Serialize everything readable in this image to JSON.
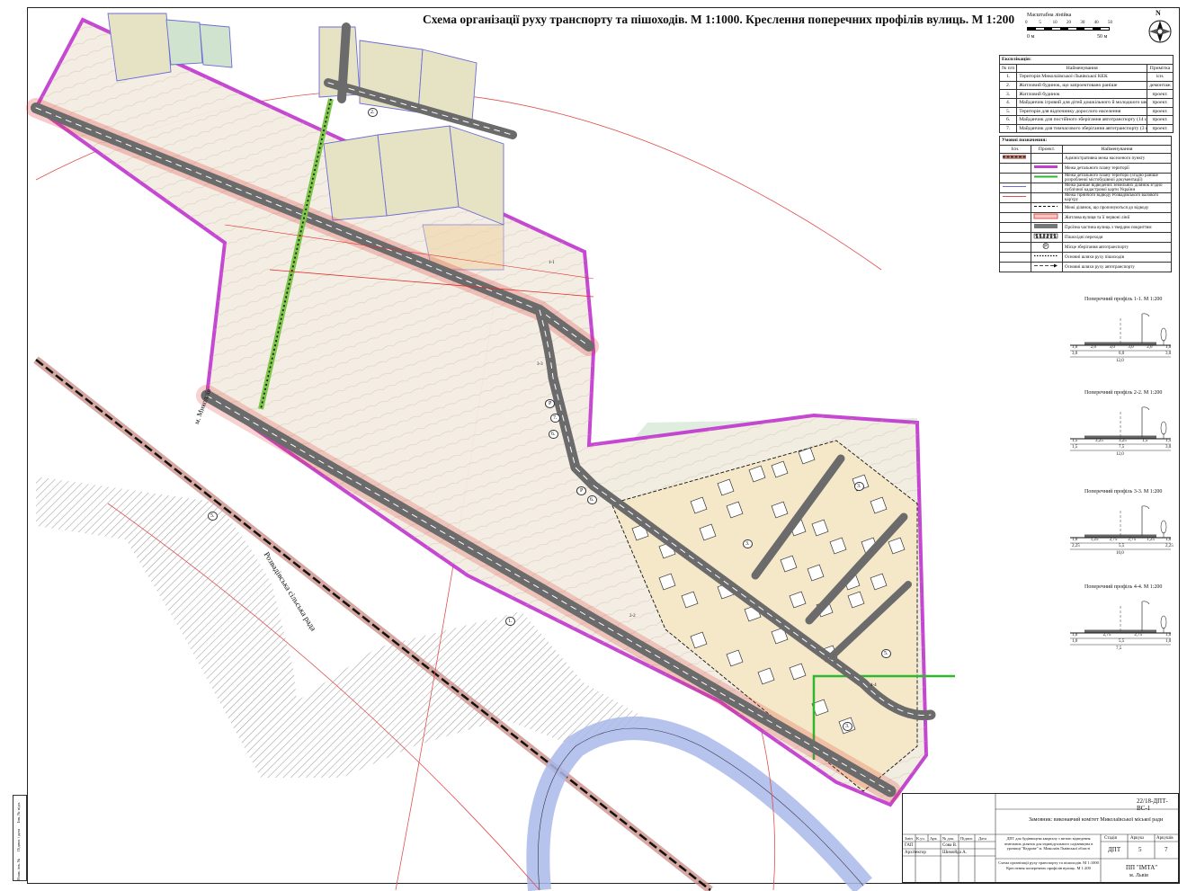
{
  "title": "Схема організації руху транспорту та пішоходів. М 1:1000. Креслення поперечних профілів вулиць. М 1:200",
  "scale": {
    "label": "Масштабна лінійка",
    "ticks": [
      "0",
      "5",
      "10",
      "20",
      "30",
      "40",
      "50"
    ],
    "left_unit": "0 м",
    "right_unit": "50 м"
  },
  "compass": {
    "north": "N"
  },
  "map_labels": {
    "city": "м. Миколаїв",
    "council": "Розвадівська сільська рада",
    "road_cross_1": "1-1",
    "road_cross_2": "2-2",
    "road_cross_3": "3-3",
    "road_cross_4": "4-4",
    "marker_1": "1.",
    "marker_2": "2.",
    "marker_3": "3.",
    "marker_5": "5.",
    "marker_6": "6.",
    "marker_7": "7.",
    "parking": "P",
    "zone_1": "1.",
    "zone_5": "5."
  },
  "explication": {
    "title": "Експлікація:",
    "headers": [
      "№ п/п",
      "Найменування",
      "Примітка"
    ],
    "rows": [
      [
        "1.",
        "Територія Миколаївської-Львівської КЕК",
        "існ."
      ],
      [
        "2.",
        "Житловий будинок, що запроектовано раніше",
        "демонтаж"
      ],
      [
        "3.",
        "Житловий будинок",
        "проект."
      ],
      [
        "4.",
        "Майданчик ігровий для дітей дошкільного й молодшого шкільного віку",
        "проект."
      ],
      [
        "5.",
        "Територія для відпочинку дорослого населення",
        "проект."
      ],
      [
        "6.",
        "Майданчик для постійного зберігання автотранспорту (14 шт.)",
        "проект."
      ],
      [
        "7.",
        "Майданчик для тимчасового зберігання автотранспорту (3 шт.)",
        "проект."
      ]
    ]
  },
  "legend": {
    "title": "Умовні позначення:",
    "headers": [
      "Існ.",
      "Проект.",
      "Найменування"
    ],
    "rows": [
      "Адміністративна межа населеного пункту",
      "Межа детального плану території",
      "Межа детального плану території (згідно раніше розробленої містобудівної документації)",
      "Межа раніше відведених земельних ділянок згідно публічної кадастрової карти України",
      "Межа гірничого відводу Розвадівського валового кар'єру",
      "Межі ділянок, що пропонуються до відводу",
      "Житлова вулиця та її червоні лінії",
      "Проїзна частина вулиць з твердим покриттям",
      "Пішохідні переходи",
      "Місце зберігання автотранспорту",
      "Основні шляхи руху пішоходів",
      "Основні шляхи руху автотранспорту"
    ]
  },
  "profiles": [
    {
      "title": "Поперечний профіль 1-1. М 1:200",
      "top": [
        "1,0",
        "2,0",
        "3,0",
        "3,0",
        "2,0",
        "1,0"
      ],
      "mid": [
        "3,0",
        "6,0",
        "3,0"
      ],
      "total": "12,0"
    },
    {
      "title": "Поперечний профіль 2-2. М 1:200",
      "top": [
        "1,5",
        "3,25",
        "3,25",
        "1,5",
        "1,5"
      ],
      "mid": [
        "1,5",
        "7,5",
        "3,0"
      ],
      "total": "12,0"
    },
    {
      "title": "Поперечний профіль 3-3. М 1:200",
      "top": [
        "1,0",
        "1,25",
        "2,75",
        "2,75",
        "1,25",
        "1,0"
      ],
      "mid": [
        "2,25",
        "5,5",
        "2,25"
      ],
      "total": "10,0"
    },
    {
      "title": "Поперечний профіль 4-4. М 1:200",
      "top": [
        "1,0",
        "2,75",
        "2,75",
        "1,0"
      ],
      "mid": [
        "1,0",
        "5,5",
        "1,0"
      ],
      "total": "7,5"
    }
  ],
  "stamp": {
    "code": "22/18-ДПТ-ВС-1",
    "customer": "Замовник: виконавчий комітет Миколаївської міської ради",
    "headers": [
      "Змін",
      "К.уч.",
      "Арк.",
      "№ док.",
      "Підпис",
      "Дата"
    ],
    "gap": "ГАП",
    "gap_name": "Сова В.",
    "architect": "Архітектор",
    "architect_name": "Шимойда А.",
    "project": "ДПТ для будівництва кварталу з метою відведення земельних ділянок для індивідуального садівництва в урочищі \"Кедрове\" м. Миколаїв Львівської області",
    "stage_h": "Стадія",
    "sheet_h": "Аркуш",
    "sheets_h": "Аркушів",
    "stage": "ДПТ",
    "sheet": "5",
    "sheets": "7",
    "drawing": "Схема організації руху транспорту та пішоходів. М 1:1000 Креслення поперечних профілів вулиць. М 1:200",
    "org": "ПП \"ІМТА\"",
    "city": "м. Львів"
  },
  "side_strip": [
    "Інв. № підл.",
    "Підпис і дата",
    "Взам. інв. №"
  ],
  "colors": {
    "boundary_magenta": "#c23ed0",
    "red_line": "#e0302a",
    "road_gray": "#6b6b6b",
    "plot_fill": "#f5e8c8",
    "green_zone": "#dcebdc",
    "water": "#a9b8ea",
    "hatch": "#8c8c8c",
    "admin_boundary": "#c98b82"
  }
}
